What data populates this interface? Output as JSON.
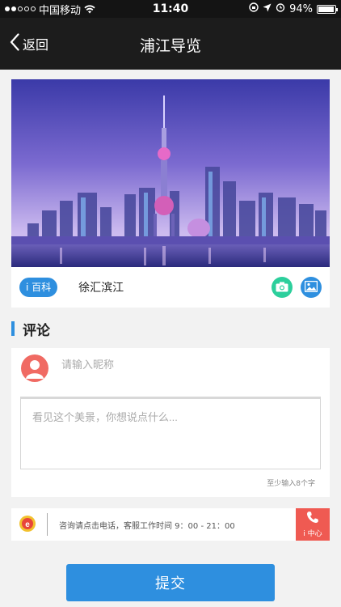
{
  "status_bar": {
    "carrier": "中国移动",
    "time": "11:40",
    "battery": "94%",
    "battery_level": 0.94
  },
  "nav": {
    "back_label": "返回",
    "title": "浦江导览"
  },
  "place": {
    "wiki_badge": "i 百科",
    "name": "徐汇滨江"
  },
  "comments": {
    "heading": "评论",
    "nickname_placeholder": "请输入昵称",
    "comment_placeholder": "看见这个美景，你想说点什么...",
    "min_hint": "至少输入8个字"
  },
  "consult": {
    "text": "咨询请点击电话，客服工作时间 9：00 - 21：00",
    "center_label": "i 中心"
  },
  "submit_label": "提交",
  "colors": {
    "accent": "#2e8fdf",
    "camera": "#2ccf9c",
    "alert": "#ef5a52",
    "nav_bg": "#1c1c1c"
  }
}
